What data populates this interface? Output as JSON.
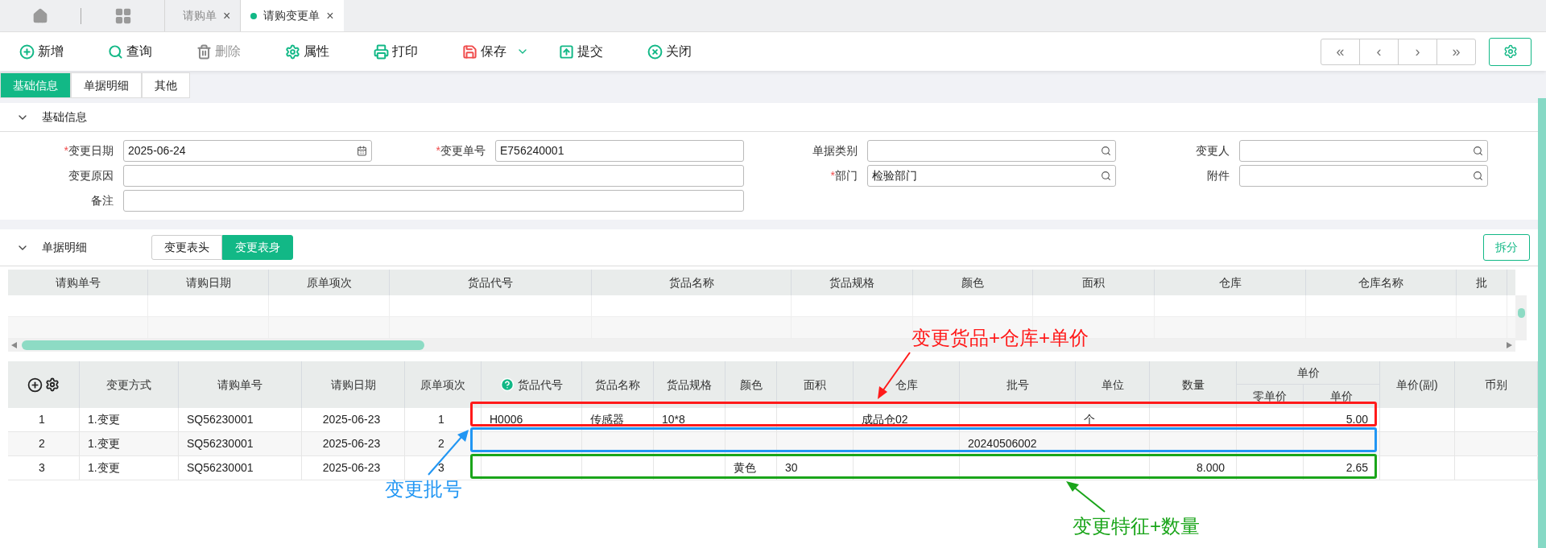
{
  "tabs": [
    {
      "label": "请购单",
      "close": "×",
      "selected": false
    },
    {
      "label": "请购变更单",
      "close": "×",
      "selected": true
    }
  ],
  "toolbar": [
    {
      "label": "新增",
      "disabled": false
    },
    {
      "label": "查询",
      "disabled": false
    },
    {
      "label": "删除",
      "disabled": true
    },
    {
      "label": "属性",
      "disabled": false
    },
    {
      "label": "打印",
      "disabled": false
    },
    {
      "label": "保存",
      "disabled": false
    },
    {
      "label": "提交",
      "disabled": false
    },
    {
      "label": "关闭",
      "disabled": false
    }
  ],
  "nav_buttons": [
    "«",
    "‹",
    "›",
    "»"
  ],
  "section_tabs": [
    {
      "label": "基础信息",
      "selected": true
    },
    {
      "label": "单据明细",
      "selected": false
    },
    {
      "label": "其他",
      "selected": false
    }
  ],
  "basic_info": {
    "title": "基础信息",
    "fields": [
      {
        "label": "变更日期",
        "required_mark": "*",
        "value": "2025-06-24",
        "kind": "date"
      },
      {
        "label": "变更单号",
        "required_mark": "*",
        "value": "E756240001",
        "kind": "text"
      },
      {
        "label": "单据类别",
        "kind": "lookup"
      },
      {
        "label": "变更人",
        "kind": "lookup"
      },
      {
        "label": "变更原因",
        "kind": "wide"
      },
      {
        "label": "部门",
        "required_mark": "*",
        "value": "检验部门",
        "kind": "lookup"
      },
      {
        "label": "附件",
        "kind": "lookup"
      },
      {
        "label": "备注",
        "kind": "wide"
      }
    ]
  },
  "detail": {
    "title": "单据明细",
    "toggle": [
      {
        "label": "变更表头",
        "selected": false
      },
      {
        "label": "变更表身",
        "selected": true
      }
    ],
    "split_button": "拆分",
    "header_table": {
      "columns": [
        "请购单号",
        "请购日期",
        "原单项次",
        "货品代号",
        "货品名称",
        "货品规格",
        "颜色",
        "面积",
        "仓库",
        "仓库名称",
        "批"
      ]
    },
    "body_table": {
      "columns": [
        {
          "kind": "tools"
        },
        {
          "label": "变更方式",
          "kind": "plain"
        },
        {
          "label": "请购单号",
          "kind": "plain"
        },
        {
          "label": "请购日期",
          "kind": "plain"
        },
        {
          "label": "原单项次",
          "kind": "plain"
        },
        {
          "label": "货品代号",
          "kind": "help"
        },
        {
          "label": "货品名称",
          "kind": "plain"
        },
        {
          "label": "货品规格",
          "kind": "plain"
        },
        {
          "label": "颜色",
          "kind": "plain"
        },
        {
          "label": "面积",
          "kind": "plain"
        },
        {
          "label": "仓库",
          "kind": "plain"
        },
        {
          "label": "批号",
          "kind": "plain"
        },
        {
          "label": "单位",
          "kind": "plain"
        },
        {
          "label": "数量",
          "kind": "plain"
        },
        {
          "label": "单价",
          "kind": "group",
          "children": [
            "零单价",
            "单价"
          ]
        },
        {
          "label": "单价(副)",
          "kind": "plain"
        },
        {
          "label": "币别",
          "kind": "plain"
        }
      ],
      "rows": [
        [
          "1",
          "1.变更",
          "SQ56230001",
          "2025-06-23",
          "1",
          "H0006",
          "传感器",
          "10*8",
          null,
          null,
          "成品仓02",
          null,
          "个",
          null,
          null,
          "5.00",
          null,
          null
        ],
        [
          "2",
          "1.变更",
          "SQ56230001",
          "2025-06-23",
          "2",
          null,
          null,
          null,
          null,
          null,
          null,
          "20240506002",
          null,
          null,
          null,
          null,
          null,
          null
        ],
        [
          "3",
          "1.变更",
          "SQ56230001",
          "2025-06-23",
          "3",
          null,
          null,
          null,
          "黄色",
          "30",
          null,
          null,
          null,
          "8.000",
          null,
          "2.65",
          null,
          null
        ]
      ]
    }
  },
  "annotations": [
    {
      "label": "变更货品+仓库+单价",
      "color": "#ff1a1a"
    },
    {
      "label": "变更批号",
      "color": "#2196f3"
    },
    {
      "label": "变更特征+数量",
      "color": "#1aa51a"
    }
  ]
}
